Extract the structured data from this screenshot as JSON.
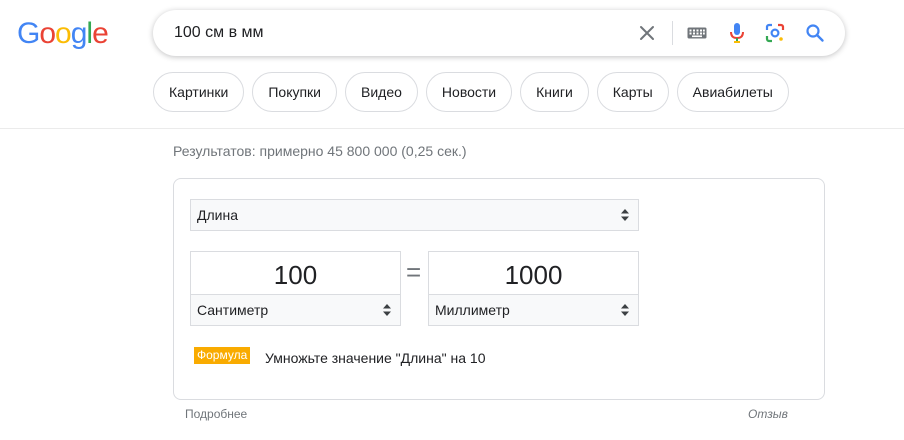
{
  "logo": {
    "letters": [
      "G",
      "o",
      "o",
      "g",
      "l",
      "e"
    ],
    "colors": [
      "#4285f4",
      "#ea4335",
      "#fbbc05",
      "#4285f4",
      "#34a853",
      "#ea4335"
    ]
  },
  "search": {
    "query": "100 см в мм"
  },
  "icons": {
    "clear": "close-icon",
    "keyboard": "keyboard-icon",
    "voice": "microphone-icon",
    "lens": "lens-icon",
    "search": "search-icon"
  },
  "chips": [
    "Картинки",
    "Покупки",
    "Видео",
    "Новости",
    "Книги",
    "Карты",
    "Авиабилеты"
  ],
  "stats": "Результатов: примерно 45 800 000 (0,25 сек.)",
  "converter": {
    "quantity": "Длина",
    "from": {
      "value": "100",
      "unit": "Сантиметр"
    },
    "equals": "=",
    "to": {
      "value": "1000",
      "unit": "Миллиметр"
    },
    "formula_label": "Формула",
    "formula_text": "Умножьте значение \"Длина\" на 10"
  },
  "footer": {
    "more": "Подробнее",
    "feedback": "Отзыв"
  },
  "colors": {
    "accent": "#1a73e8",
    "badge": "#f9ab00",
    "muted": "#70757a"
  }
}
